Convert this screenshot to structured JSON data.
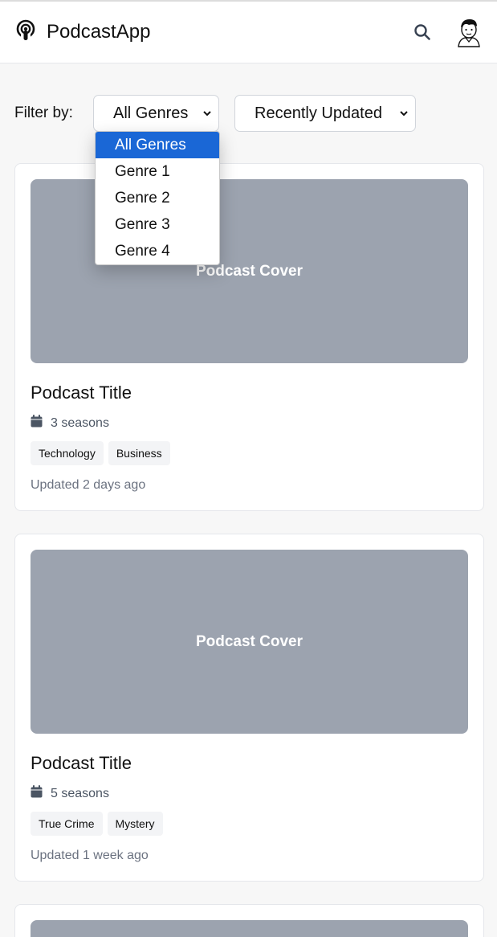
{
  "app": {
    "title": "PodcastApp",
    "logo_icon": "podcast-icon"
  },
  "header": {
    "search_icon": "search-icon",
    "avatar_icon": "avatar"
  },
  "filters": {
    "label": "Filter by:",
    "genre": {
      "selected": "All Genres",
      "options": [
        "All Genres",
        "Genre 1",
        "Genre 2",
        "Genre 3",
        "Genre 4"
      ],
      "open": true
    },
    "sort": {
      "selected": "Recently Updated"
    }
  },
  "podcasts": [
    {
      "cover_text": "Podcast Cover",
      "title": "Podcast Title",
      "seasons": "3 seasons",
      "tags": [
        "Technology",
        "Business"
      ],
      "updated": "Updated 2 days ago"
    },
    {
      "cover_text": "Podcast Cover",
      "title": "Podcast Title",
      "seasons": "5 seasons",
      "tags": [
        "True Crime",
        "Mystery"
      ],
      "updated": "Updated 1 week ago"
    }
  ],
  "colors": {
    "accent": "#1a67d6",
    "cover": "#9ca3af",
    "tag_bg": "#f3f4f6",
    "muted_text": "#6b7280"
  }
}
